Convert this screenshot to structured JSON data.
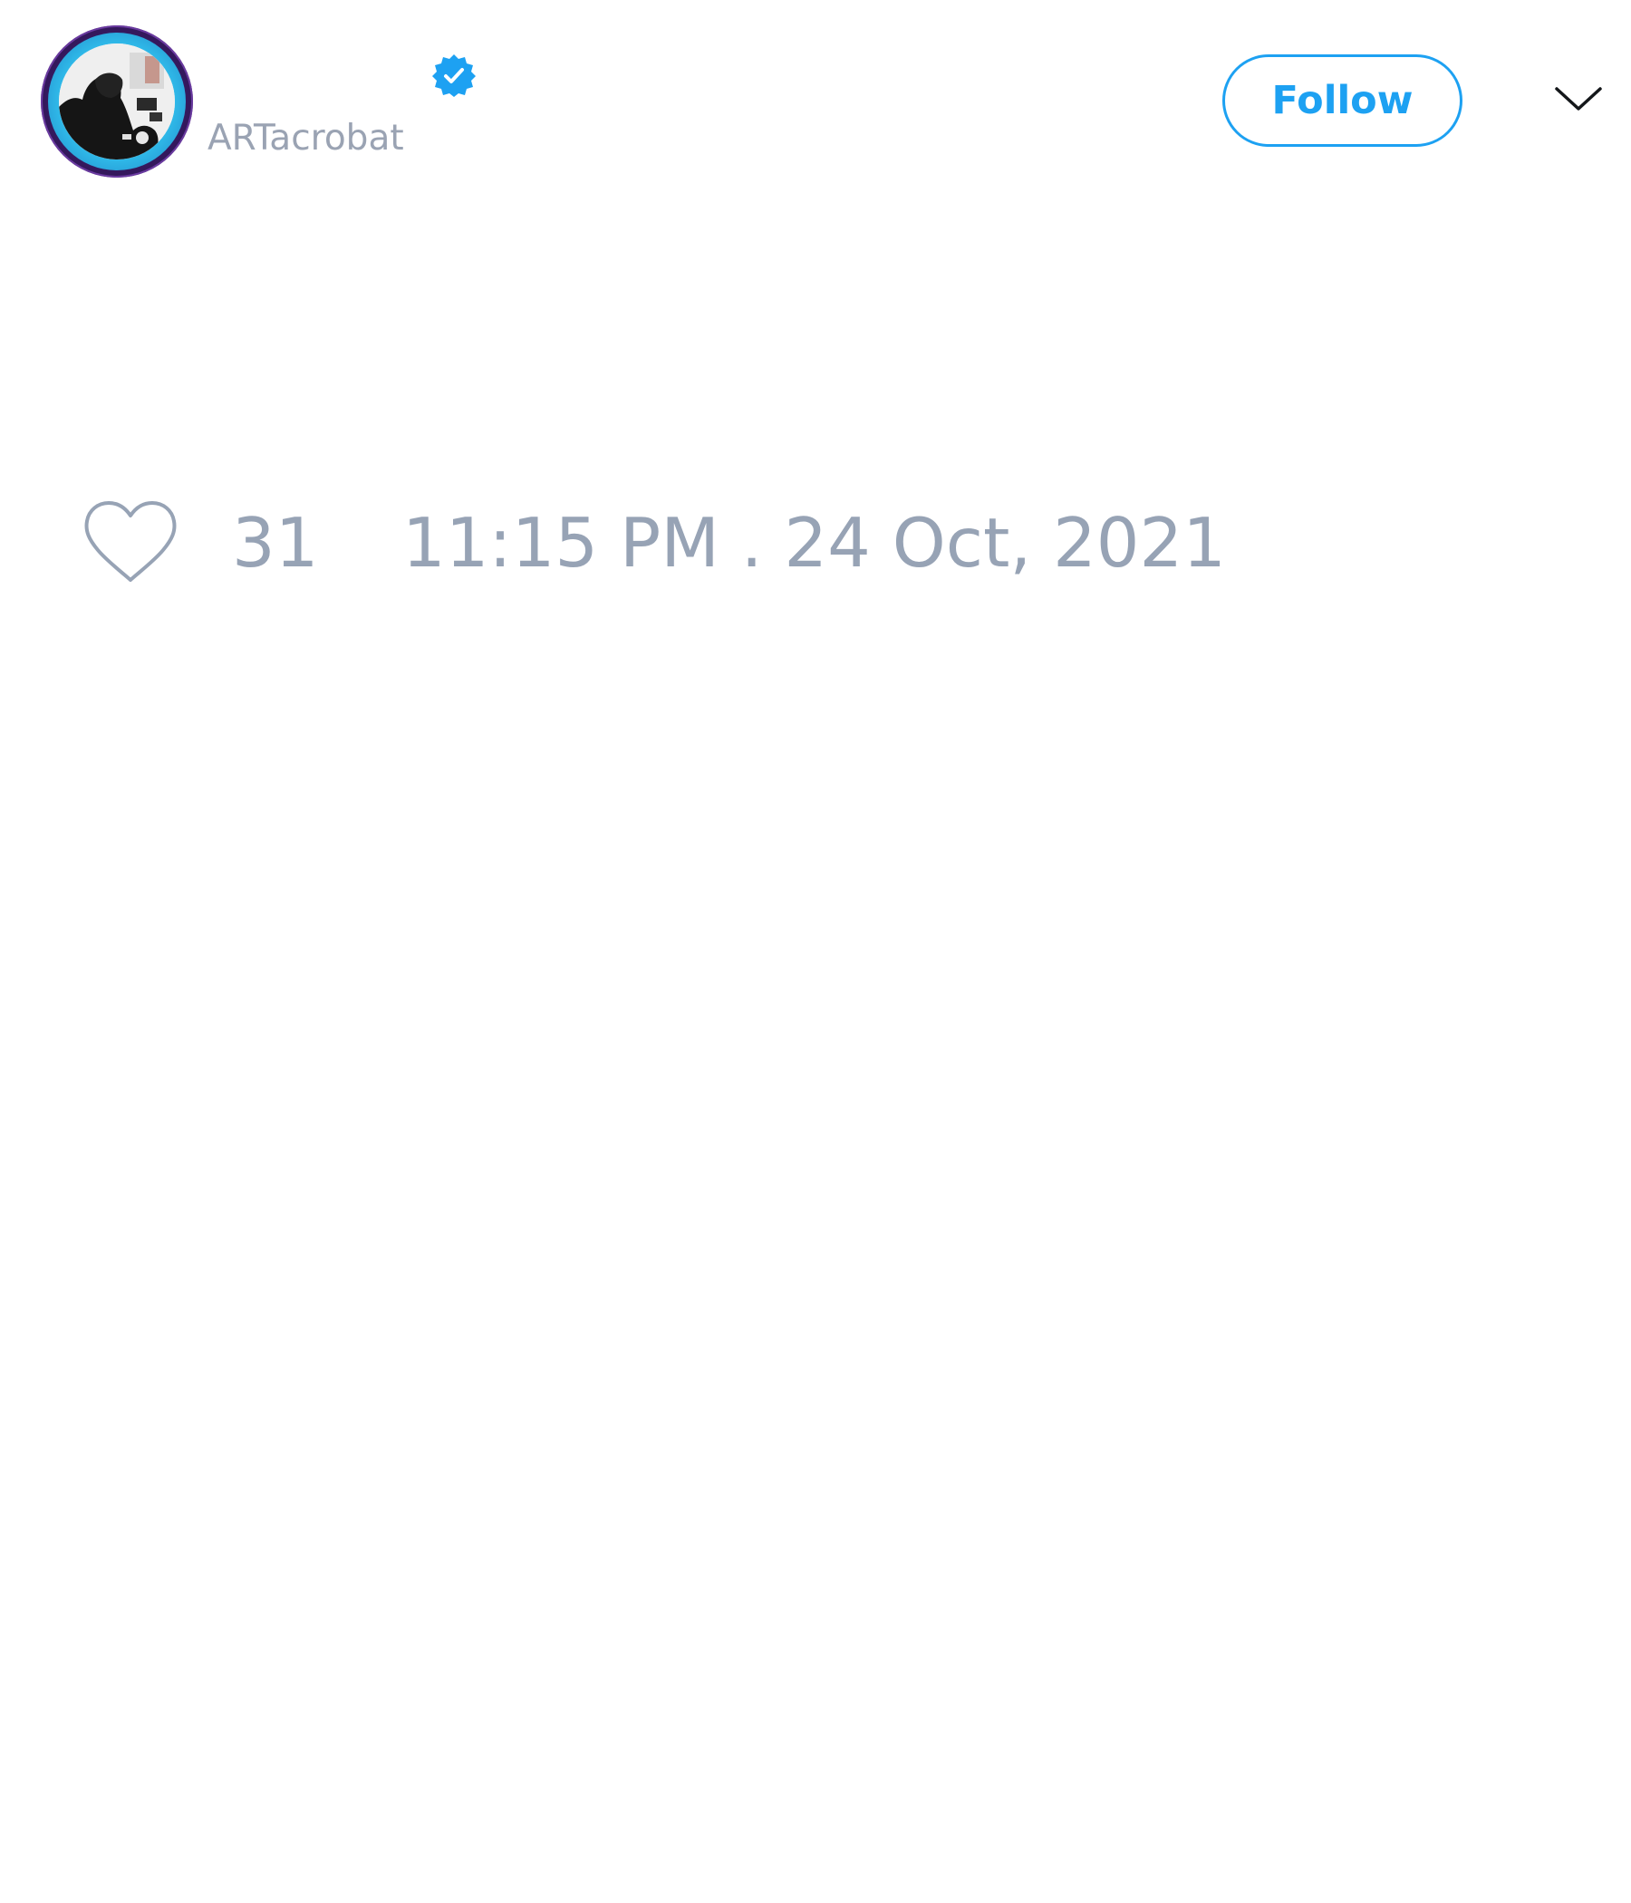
{
  "user": {
    "display_name": "",
    "handle": "ARTacrobat",
    "verified": true,
    "avatar": "profile-photo"
  },
  "actions": {
    "follow_label": "Follow",
    "more_icon": "chevron-down-icon"
  },
  "tweet": {
    "text": ""
  },
  "meta": {
    "like_icon": "heart-icon",
    "like_count": "31",
    "timestamp": "11:15 PM . 24 Oct, 2021"
  },
  "colors": {
    "accent": "#1da1f2",
    "muted_text": "#97a3b5",
    "background": "#ffffff"
  }
}
